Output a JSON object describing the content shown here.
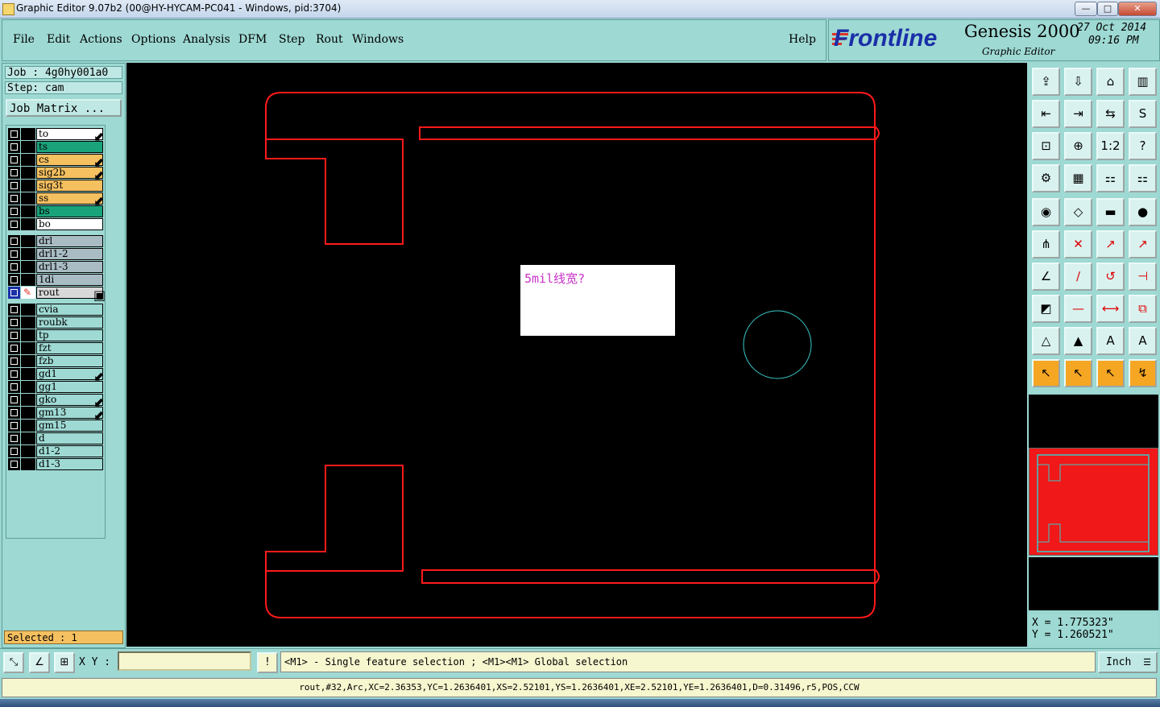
{
  "window": {
    "title": "Graphic Editor 9.07b2 (00@HY-HYCAM-PC041 - Windows, pid:3704)",
    "buttons": [
      "—",
      "□",
      "✕"
    ]
  },
  "menu": {
    "items": [
      "File",
      "Edit",
      "Actions",
      "Options",
      "Analysis",
      "DFM",
      "Step",
      "Rout",
      "Windows"
    ],
    "help": "Help"
  },
  "brand": {
    "logo": "Frontline",
    "product": "Genesis 2000",
    "subtitle": "Graphic Editor",
    "date": "27 Oct 2014",
    "time": "09:16 PM"
  },
  "job": {
    "job_line": "Job : 4g0hy001a0",
    "step_line": "Step: cam",
    "matrix_button": "Job Matrix ..."
  },
  "layers": [
    {
      "name": "to",
      "color": "#ffffff",
      "mark": "⬋"
    },
    {
      "name": "ts",
      "color": "#1aa37a",
      "mark": ""
    },
    {
      "name": "cs",
      "color": "#f5c060",
      "mark": "⬋"
    },
    {
      "name": "sig2b",
      "color": "#f5c060",
      "mark": "⬋"
    },
    {
      "name": "sig3t",
      "color": "#f5c060",
      "mark": ""
    },
    {
      "name": "ss",
      "color": "#f5c060",
      "mark": "⬋"
    },
    {
      "name": "bs",
      "color": "#1aa37a",
      "mark": ""
    },
    {
      "name": "bo",
      "color": "#ffffff",
      "mark": ""
    },
    {
      "name": "drl",
      "color": "#a9bcc4",
      "mark": ""
    },
    {
      "name": "drl1-2",
      "color": "#a9bcc4",
      "mark": ""
    },
    {
      "name": "drl1-3",
      "color": "#a9bcc4",
      "mark": ""
    },
    {
      "name": "1di",
      "color": "#a9bcc4",
      "mark": ""
    },
    {
      "name": "rout",
      "color": "#d9d9d9",
      "mark": "▣"
    },
    {
      "name": "cvia",
      "color": "#9ed9d3",
      "mark": ""
    },
    {
      "name": "roubk",
      "color": "#9ed9d3",
      "mark": ""
    },
    {
      "name": "tp",
      "color": "#9ed9d3",
      "mark": ""
    },
    {
      "name": "fzt",
      "color": "#9ed9d3",
      "mark": ""
    },
    {
      "name": "fzb",
      "color": "#9ed9d3",
      "mark": ""
    },
    {
      "name": "gd1",
      "color": "#9ed9d3",
      "mark": "⬋"
    },
    {
      "name": "gg1",
      "color": "#9ed9d3",
      "mark": ""
    },
    {
      "name": "gko",
      "color": "#9ed9d3",
      "mark": "⬋"
    },
    {
      "name": "gm13",
      "color": "#9ed9d3",
      "mark": "⬋"
    },
    {
      "name": "gm15",
      "color": "#9ed9d3",
      "mark": ""
    },
    {
      "name": "d",
      "color": "#9ed9d3",
      "mark": ""
    },
    {
      "name": "d1-2",
      "color": "#9ed9d3",
      "mark": ""
    },
    {
      "name": "d1-3",
      "color": "#9ed9d3",
      "mark": ""
    }
  ],
  "selected": "Selected : 1",
  "canvas": {
    "note_text": "5mil线宽?",
    "outline_color": "#ff1a1a",
    "circle_color": "#3cc8c8"
  },
  "toolbox": {
    "tools": [
      "⇪",
      "⇩",
      "⌂",
      "▥",
      "⇤",
      "⇥",
      "⇆",
      "S",
      "⊡",
      "⊕",
      "1:2",
      "?",
      "⚙",
      "▦",
      "⚏",
      "⚏",
      "◉",
      "◇",
      "▬",
      "●",
      "⋔",
      "✕",
      "↗",
      "↗",
      "∠",
      "∕",
      "↺",
      "⊣",
      "◩",
      "—",
      "⟷",
      "⧉",
      "△",
      "▲",
      "A",
      "A",
      "↖",
      "↖",
      "↖",
      "↯"
    ]
  },
  "coords": {
    "x": "X = 1.775323\"",
    "y": "Y = 1.260521\""
  },
  "bottom": {
    "xy_label": "X Y :",
    "xy_value": "",
    "hint": "<M1> - Single feature selection ; <M1><M1> Global selection",
    "unit": "Inch",
    "status": "rout,#32,Arc,XC=2.36353,YC=1.2636401,XS=2.52101,YS=1.2636401,XE=2.52101,YE=1.2636401,D=0.31496,r5,POS,CCW"
  }
}
